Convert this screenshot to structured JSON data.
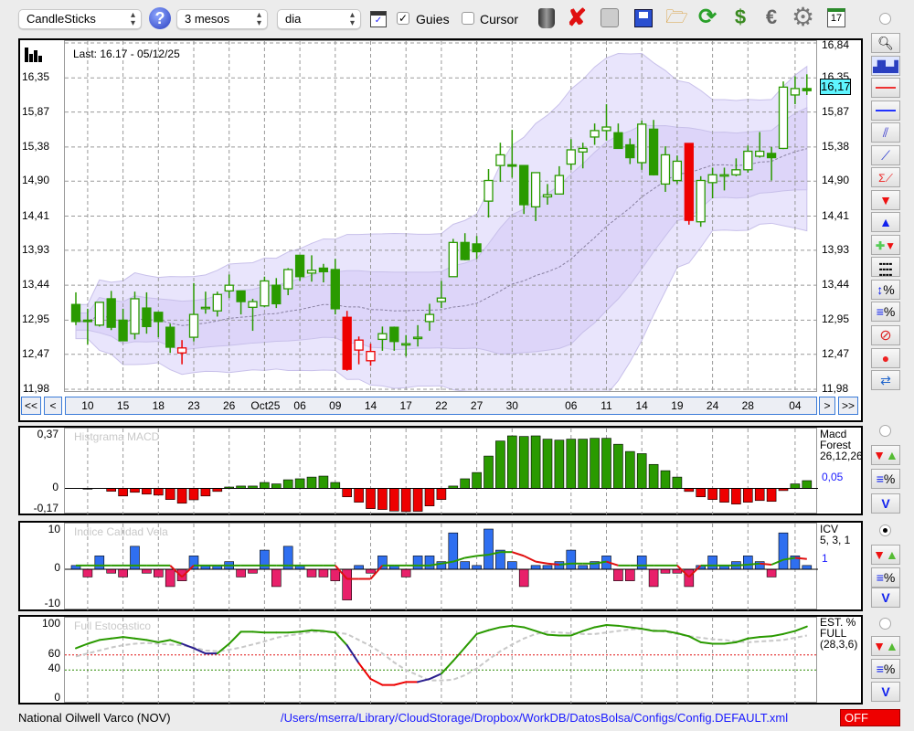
{
  "toolbar": {
    "chart_type": "CandleSticks",
    "period": "3 mesos",
    "interval": "dia",
    "guides_label": "Guies",
    "guides_checked": true,
    "cursor_label": "Cursor",
    "cursor_checked": false,
    "help": "?",
    "icons": [
      "trash-icon",
      "delete-icon",
      "lightbulb-icon",
      "save-icon",
      "folder-icon",
      "refresh-icon",
      "sync-icon",
      "euro-icon",
      "gear-icon",
      "calendar-icon"
    ],
    "calendar_day": "17"
  },
  "main": {
    "last_label": "Last: 16.17 - 05/12/25",
    "last_badge": "16,17",
    "last_value": 16.17,
    "price_ticks": [
      {
        "label": "16,84",
        "v": 16.84
      },
      {
        "label": "16,35",
        "v": 16.35
      },
      {
        "label": "15,87",
        "v": 15.87
      },
      {
        "label": "15,38",
        "v": 15.38
      },
      {
        "label": "14,90",
        "v": 14.9
      },
      {
        "label": "14,41",
        "v": 14.41
      },
      {
        "label": "13,93",
        "v": 13.93
      },
      {
        "label": "13,44",
        "v": 13.44
      },
      {
        "label": "12,95",
        "v": 12.95
      },
      {
        "label": "12,47",
        "v": 12.47
      },
      {
        "label": "11,98",
        "v": 11.98
      }
    ],
    "ylim": [
      11.98,
      16.84
    ],
    "nav": {
      "first": "<<",
      "prev": "<",
      "next": ">",
      "last": ">>"
    },
    "date_labels": [
      {
        "label": "10",
        "i": 1
      },
      {
        "label": "15",
        "i": 4
      },
      {
        "label": "18",
        "i": 7
      },
      {
        "label": "23",
        "i": 10
      },
      {
        "label": "26",
        "i": 13
      },
      {
        "label": "Oct25",
        "i": 16
      },
      {
        "label": "06",
        "i": 19
      },
      {
        "label": "09",
        "i": 22
      },
      {
        "label": "14",
        "i": 25
      },
      {
        "label": "17",
        "i": 28
      },
      {
        "label": "22",
        "i": 31
      },
      {
        "label": "27",
        "i": 34
      },
      {
        "label": "30",
        "i": 37
      },
      {
        "label": "06",
        "i": 42
      },
      {
        "label": "11",
        "i": 45
      },
      {
        "label": "14",
        "i": 48
      },
      {
        "label": "19",
        "i": 51
      },
      {
        "label": "24",
        "i": 54
      },
      {
        "label": "28",
        "i": 57
      },
      {
        "label": "04",
        "i": 61
      }
    ],
    "candles": [
      [
        13.17,
        13.34,
        12.88,
        12.93,
        "g"
      ],
      [
        12.95,
        13.11,
        12.61,
        12.93,
        "g"
      ],
      [
        12.88,
        13.2,
        12.86,
        13.2,
        "g"
      ],
      [
        13.25,
        13.36,
        12.81,
        12.85,
        "g"
      ],
      [
        12.95,
        13.11,
        12.66,
        12.66,
        "g"
      ],
      [
        12.76,
        13.35,
        12.68,
        13.25,
        "g"
      ],
      [
        13.12,
        13.34,
        12.76,
        12.86,
        "g"
      ],
      [
        13.06,
        13.07,
        12.71,
        12.93,
        "g"
      ],
      [
        12.85,
        12.9,
        12.49,
        12.57,
        "g"
      ],
      [
        12.49,
        12.67,
        12.33,
        12.56,
        "r"
      ],
      [
        12.71,
        13.47,
        12.65,
        13.03,
        "g"
      ],
      [
        13.13,
        13.35,
        13.04,
        13.13,
        "g"
      ],
      [
        13.08,
        13.35,
        13.0,
        13.31,
        "g"
      ],
      [
        13.36,
        13.59,
        13.26,
        13.44,
        "g"
      ],
      [
        13.36,
        13.36,
        13.03,
        13.21,
        "g"
      ],
      [
        13.13,
        13.25,
        12.8,
        13.21,
        "g"
      ],
      [
        13.15,
        13.56,
        13.13,
        13.5,
        "g"
      ],
      [
        13.44,
        13.54,
        13.12,
        13.18,
        "g"
      ],
      [
        13.39,
        13.68,
        13.3,
        13.66,
        "g"
      ],
      [
        13.86,
        13.86,
        13.5,
        13.56,
        "g"
      ],
      [
        13.61,
        13.86,
        13.49,
        13.65,
        "g"
      ],
      [
        13.68,
        13.74,
        13.48,
        13.63,
        "g"
      ],
      [
        13.66,
        13.81,
        13.03,
        13.11,
        "g"
      ],
      [
        12.99,
        13.08,
        12.24,
        12.26,
        "r"
      ],
      [
        12.53,
        12.72,
        12.33,
        12.67,
        "r"
      ],
      [
        12.38,
        12.62,
        12.31,
        12.51,
        "r"
      ],
      [
        12.68,
        12.86,
        12.52,
        12.76,
        "g"
      ],
      [
        12.85,
        12.86,
        12.52,
        12.65,
        "g"
      ],
      [
        12.62,
        12.74,
        12.44,
        12.62,
        "g"
      ],
      [
        12.71,
        12.88,
        12.58,
        12.71,
        "g"
      ],
      [
        12.93,
        13.18,
        12.8,
        13.03,
        "g"
      ],
      [
        13.21,
        13.5,
        13.12,
        13.26,
        "g"
      ],
      [
        13.56,
        14.09,
        13.56,
        14.04,
        "g"
      ],
      [
        14.04,
        14.17,
        13.79,
        13.8,
        "g"
      ],
      [
        14.02,
        14.13,
        13.81,
        13.91,
        "g"
      ],
      [
        14.62,
        15.07,
        14.39,
        14.91,
        "g"
      ],
      [
        15.12,
        15.44,
        14.89,
        15.27,
        "g"
      ],
      [
        15.13,
        15.62,
        14.95,
        15.11,
        "g"
      ],
      [
        15.12,
        15.12,
        14.44,
        14.57,
        "g"
      ],
      [
        14.54,
        15.02,
        14.34,
        15.02,
        "g"
      ],
      [
        14.68,
        14.86,
        14.57,
        14.71,
        "g"
      ],
      [
        14.72,
        15.11,
        14.72,
        14.98,
        "g"
      ],
      [
        15.14,
        15.49,
        15.06,
        15.34,
        "g"
      ],
      [
        15.31,
        15.44,
        15.08,
        15.36,
        "g"
      ],
      [
        15.52,
        15.71,
        15.41,
        15.61,
        "g"
      ],
      [
        15.61,
        15.98,
        15.47,
        15.66,
        "g"
      ],
      [
        15.58,
        15.71,
        15.36,
        15.36,
        "g"
      ],
      [
        15.41,
        15.5,
        15.14,
        15.23,
        "g"
      ],
      [
        15.16,
        15.75,
        15.06,
        15.7,
        "g"
      ],
      [
        15.63,
        15.76,
        14.98,
        14.99,
        "g"
      ],
      [
        14.86,
        15.39,
        14.75,
        15.27,
        "g"
      ],
      [
        14.91,
        15.26,
        14.86,
        15.18,
        "g"
      ],
      [
        15.43,
        15.43,
        14.29,
        14.35,
        "r"
      ],
      [
        14.33,
        14.97,
        14.26,
        14.91,
        "g"
      ],
      [
        14.88,
        15.09,
        14.66,
        14.99,
        "g"
      ],
      [
        14.99,
        15.09,
        14.77,
        14.99,
        "g"
      ],
      [
        14.99,
        15.22,
        14.97,
        15.06,
        "g"
      ],
      [
        15.06,
        15.4,
        15.02,
        15.32,
        "g"
      ],
      [
        15.25,
        15.59,
        15.23,
        15.32,
        "g"
      ],
      [
        15.29,
        15.38,
        14.91,
        15.23,
        "g"
      ],
      [
        15.36,
        16.3,
        15.35,
        16.22,
        "g"
      ],
      [
        16.11,
        16.37,
        15.98,
        16.2,
        "g"
      ],
      [
        16.2,
        16.4,
        16.11,
        16.17,
        "g"
      ]
    ]
  },
  "macd": {
    "title": "Histgrama MACD",
    "legend": [
      "Macd",
      "Forest",
      "26,12,26"
    ],
    "current": "0,05",
    "ticks": [
      {
        "label": "0,37",
        "v": 0.37
      },
      {
        "label": "0",
        "v": 0
      },
      {
        "label": "-0,17",
        "v": -0.17
      }
    ],
    "ylim": [
      -0.17,
      0.37
    ],
    "values": [
      0,
      -0.005,
      0,
      -0.02,
      -0.053,
      -0.027,
      -0.04,
      -0.047,
      -0.078,
      -0.104,
      -0.08,
      -0.053,
      -0.021,
      0.01,
      0.017,
      0.017,
      0.042,
      0.032,
      0.061,
      0.068,
      0.08,
      0.087,
      0.042,
      -0.059,
      -0.097,
      -0.142,
      -0.148,
      -0.159,
      -0.163,
      -0.161,
      -0.123,
      -0.078,
      0.017,
      0.068,
      0.112,
      0.228,
      0.334,
      0.37,
      0.366,
      0.37,
      0.347,
      0.34,
      0.347,
      0.347,
      0.353,
      0.353,
      0.311,
      0.26,
      0.245,
      0.169,
      0.125,
      0.08,
      -0.021,
      -0.059,
      -0.078,
      -0.097,
      -0.11,
      -0.097,
      -0.085,
      -0.091,
      -0.015,
      0.032,
      0.055
    ]
  },
  "icv": {
    "title": "Indice Calidad Vela",
    "legend": [
      "ICV",
      "5, 3, 1"
    ],
    "current": "1",
    "ticks": [
      {
        "label": "10",
        "v": 10
      },
      {
        "label": "0",
        "v": 0
      },
      {
        "label": "-10",
        "v": -10
      }
    ],
    "ylim": [
      -10,
      10.5
    ],
    "values": [
      1,
      -2,
      3.5,
      -1,
      -2,
      6,
      -1,
      -2,
      -4.5,
      -3,
      3.5,
      1,
      1,
      2,
      -2,
      -1,
      5,
      -4.5,
      6,
      1,
      -2,
      -2,
      -3,
      -8,
      1,
      -1,
      3.5,
      1,
      -2,
      3.5,
      3.5,
      2,
      9.5,
      2,
      1,
      10.5,
      5,
      2,
      -4.5,
      1,
      1,
      2,
      5,
      1,
      2,
      3.5,
      -3,
      -3,
      3.5,
      -4.5,
      -1,
      -1,
      -4.5,
      1,
      3.5,
      1,
      2,
      3.5,
      2,
      -2,
      9.5,
      3.5,
      1
    ],
    "line": [
      1,
      1,
      1,
      1,
      1,
      1,
      1,
      1,
      1,
      -2,
      1,
      1,
      1,
      1,
      1,
      1,
      1,
      1,
      1,
      1,
      1,
      1,
      1,
      -2.5,
      -2.5,
      -2.5,
      1,
      1,
      1,
      1,
      1,
      1.5,
      2,
      3,
      3.5,
      3.8,
      4.5,
      4.5,
      3.5,
      2,
      1.5,
      1.2,
      1.5,
      1.5,
      1.5,
      2,
      1,
      1,
      1,
      1,
      1,
      1,
      -2,
      1,
      1,
      1,
      1,
      1.2,
      1.5,
      1.2,
      2.5,
      3,
      2.7
    ]
  },
  "stoch": {
    "title": "Full Estocastico",
    "legend": [
      "EST. %",
      "FULL",
      "(28,3,6)"
    ],
    "ticks": [
      {
        "label": "100",
        "v": 100
      },
      {
        "label": "60",
        "v": 60
      },
      {
        "label": "40",
        "v": 40
      },
      {
        "label": "0",
        "v": 0
      }
    ],
    "upper_level": 60,
    "lower_level": 40,
    "ylim": [
      0,
      100
    ],
    "k": [
      69,
      75,
      80,
      82,
      84,
      82,
      80,
      77,
      80,
      75,
      69,
      62,
      62,
      75,
      91,
      91,
      90,
      90,
      90,
      91,
      93,
      92,
      90,
      73,
      49,
      28,
      20,
      20,
      24,
      24,
      28,
      35,
      52,
      70,
      88,
      93,
      97,
      99,
      97,
      92,
      87,
      86,
      86,
      92,
      97,
      100,
      99,
      97,
      95,
      92,
      92,
      89,
      85,
      77,
      75,
      75,
      77,
      82,
      84,
      85,
      88,
      92,
      98
    ],
    "d": [
      58,
      62,
      66,
      70,
      73,
      75,
      76,
      75,
      74,
      73,
      70,
      66,
      65,
      67,
      70,
      74,
      78,
      83,
      86,
      88,
      91,
      91,
      90,
      88,
      80,
      72,
      62,
      50,
      40,
      33,
      26,
      26,
      27,
      33,
      42,
      54,
      65,
      74,
      82,
      88,
      91,
      90,
      89,
      88,
      88,
      90,
      92,
      94,
      95,
      93,
      91,
      88,
      85,
      83,
      81,
      80,
      78,
      77,
      78,
      79,
      80,
      83,
      86
    ]
  },
  "footer": {
    "instrument": "National Oilwell Varco (NOV)",
    "config_path": "/Users/mserra/Library/CloudStorage/Dropbox/WorkDB/DatosBolsa/Configs/Config.DEFAULT.xml",
    "status": "OFF"
  },
  "colors": {
    "up": "#2a9a00",
    "down": "#ee0000",
    "band_outer": "#e9e5fc",
    "band_inner": "#ddd5f9",
    "cyan": "#5ff5ff",
    "link": "#1a1aff",
    "icv_pos": "#2f6ff0",
    "icv_neg": "#e8206a",
    "stoch_down": "#2b1f8f"
  }
}
